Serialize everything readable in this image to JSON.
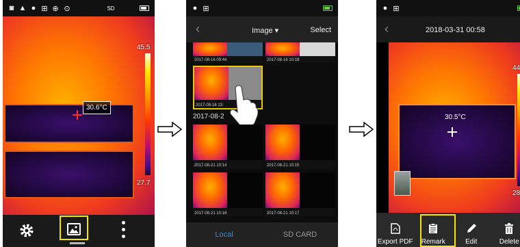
{
  "screen1": {
    "scale_max": "45.5",
    "scale_min": "27.7",
    "spot_temp": "30.6°C",
    "icons": [
      "camera-icon",
      "signal-icon",
      "location-icon",
      "grid-icon",
      "zoom-icon",
      "target-icon",
      "sd-card-icon",
      "battery-icon"
    ],
    "bottom": [
      "settings-icon",
      "gallery-icon",
      "more-icon"
    ],
    "sd_label": "SD"
  },
  "screen2": {
    "title": "Image ▾",
    "select_label": "Select",
    "back_glyph": "‹",
    "section_date": "2017-08-2",
    "thumbs": [
      {
        "date": "2017-08-16 09:44"
      },
      {
        "date": "2017-08-16 10:18"
      },
      {
        "date": "2017-08-16 13:"
      },
      {
        "date": "2017-08-21 10:14"
      },
      {
        "date": "2017-08-21 10:15"
      },
      {
        "date": "2017-08-21 10:16"
      },
      {
        "date": "2017-08-21 10:17"
      }
    ],
    "tabs": [
      {
        "label": "Local",
        "color": "#2f8fe6"
      },
      {
        "label": "SD CARD",
        "color": "#9a9a9a"
      }
    ]
  },
  "screen3": {
    "title": "2018-03-31 00:58",
    "back_glyph": "‹",
    "scale_max": "44.8",
    "scale_min": "28.5",
    "spot_temp": "30.5°C",
    "buttons": [
      {
        "label": "Export PDF",
        "icon": "pdf-icon"
      },
      {
        "label": "Remark",
        "icon": "remark-icon"
      },
      {
        "label": "Edit",
        "icon": "edit-icon"
      },
      {
        "label": "Delete",
        "icon": "delete-icon"
      }
    ]
  },
  "colors": {
    "highlight": "#f6e600",
    "local_tab": "#2f8fe6"
  }
}
